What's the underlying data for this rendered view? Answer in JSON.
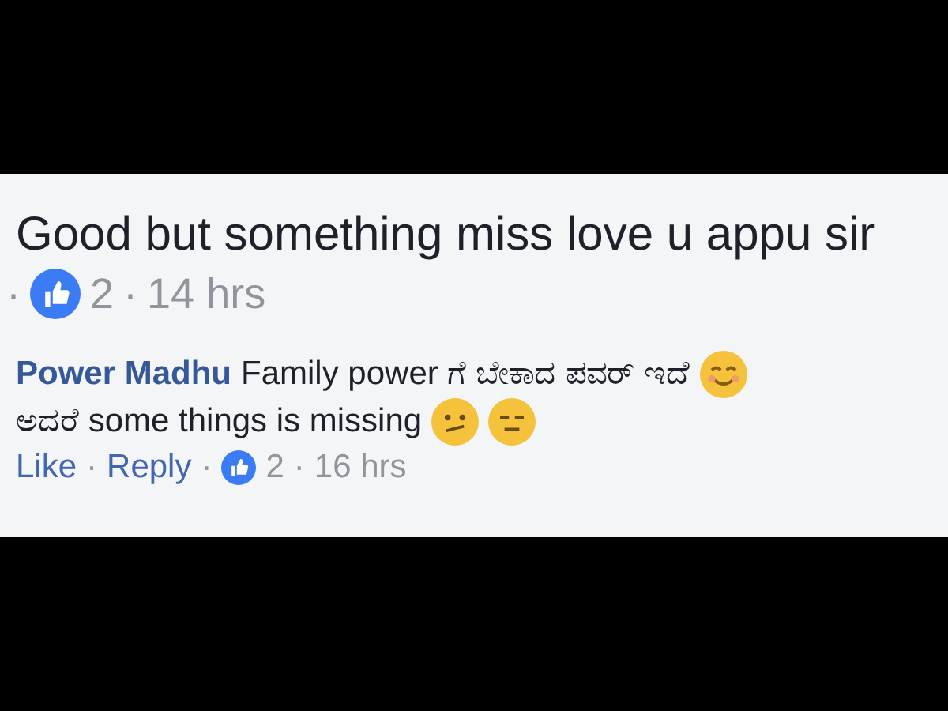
{
  "comment": {
    "text": "Good but something miss love u appu sir",
    "meta": [
      {
        "kind": "sep",
        "text": "·"
      },
      {
        "kind": "likes",
        "text": "2"
      },
      {
        "kind": "sep",
        "text": "·"
      },
      {
        "kind": "time",
        "text": "14 hrs"
      }
    ]
  },
  "reply": {
    "author": "Power Madhu",
    "lines": [
      {
        "text": "Family power ಗೆ ಬೇಕಾದ ಪವರ್ ಇದೆ",
        "emojis": [
          {
            "kind": "smile"
          }
        ]
      },
      {
        "text": "ಅದರೆ some things is missing",
        "emojis": [
          {
            "kind": "confused"
          },
          {
            "kind": "neutral"
          }
        ]
      }
    ],
    "meta": [
      {
        "kind": "link",
        "text": "Like"
      },
      {
        "kind": "sep",
        "text": "·"
      },
      {
        "kind": "link",
        "text": "Reply"
      },
      {
        "kind": "sep",
        "text": "·"
      },
      {
        "kind": "likes",
        "text": "2"
      },
      {
        "kind": "sep",
        "text": "·"
      },
      {
        "kind": "time",
        "text": "16 hrs"
      }
    ]
  }
}
